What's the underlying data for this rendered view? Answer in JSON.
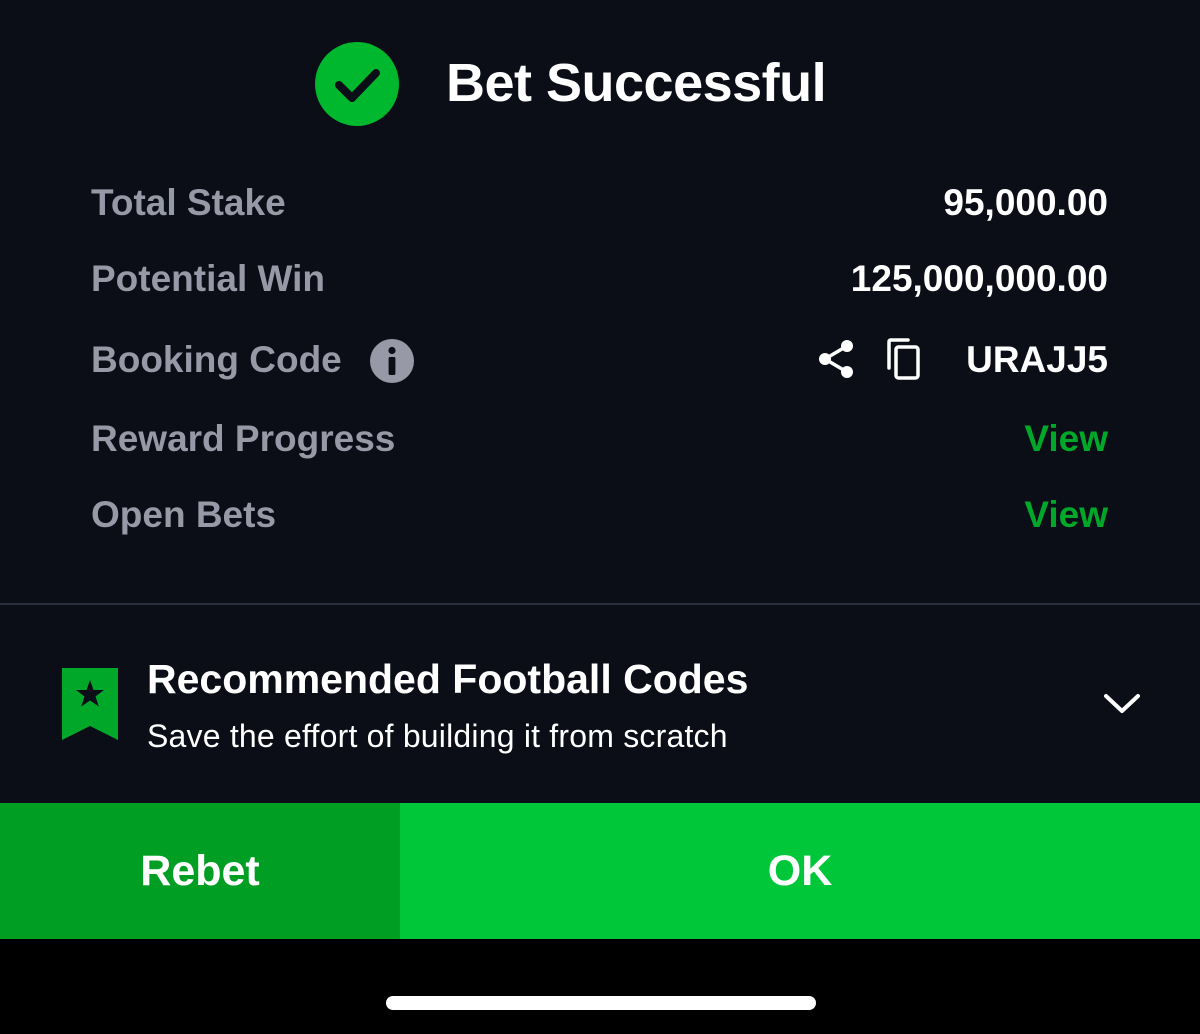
{
  "header": {
    "title": "Bet Successful",
    "icon": "check-circle-icon",
    "icon_color": "#00b82e"
  },
  "summary": {
    "total_stake": {
      "label": "Total Stake",
      "value": "95,000.00"
    },
    "potential_win": {
      "label": "Potential Win",
      "value": "125,000,000.00"
    },
    "booking_code": {
      "label": "Booking Code",
      "value": "URAJJ5",
      "icons": [
        "info-icon",
        "share-icon",
        "copy-icon"
      ]
    },
    "reward_progress": {
      "label": "Reward Progress",
      "link": "View"
    },
    "open_bets": {
      "label": "Open Bets",
      "link": "View"
    }
  },
  "recommended": {
    "title": "Recommended Football Codes",
    "subtitle": "Save the effort of building it from scratch",
    "icon": "bookmark-star-icon",
    "toggle_icon": "chevron-down-icon"
  },
  "actions": {
    "rebet_label": "Rebet",
    "ok_label": "OK"
  },
  "colors": {
    "background": "#0b0e16",
    "accent_green": "#00c73a",
    "dark_green": "#009f23",
    "link_green": "#00a82a",
    "muted_text": "#9799a6"
  }
}
